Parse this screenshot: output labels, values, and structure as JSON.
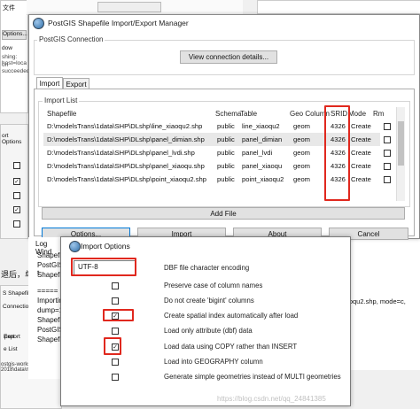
{
  "bg_fragments": {
    "top_left_menu": "文件",
    "options_btn": "Options...",
    "log_lines": [
      "dow",
      "shing: host=loca",
      "on succeeded"
    ],
    "port_options": "ort Options",
    "chinese_snippet": "退后，单",
    "shapefile_se": "S Shapefile Se",
    "connection": "Connection",
    "port_label": "port",
    "export_label": "Export",
    "file_list": "e List",
    "path_snippet": "ostgis-workshop-2018\\data\\nyc",
    "right_snippet": "iaoqu2.shp, mode=c,"
  },
  "main_window": {
    "title": "PostGIS Shapefile Import/Export Manager",
    "connection_group": "PostGIS Connection",
    "view_connection_btn": "View connection details...",
    "tabs": [
      "Import",
      "Export"
    ],
    "import_list_label": "Import List",
    "columns": [
      "Shapefile",
      "Schema",
      "Table",
      "Geo Column",
      "SRID",
      "Mode",
      "Rm"
    ],
    "rows": [
      {
        "shapefile": "D:\\modelsTrans\\1data\\SHP\\DLshp\\line_xiaoqu2.shp",
        "schema": "public",
        "table": "line_xiaoqu2",
        "geo": "geom",
        "srid": "4326",
        "mode": "Create",
        "rm": false
      },
      {
        "shapefile": "D:\\modelsTrans\\1data\\SHP\\DLshp\\panel_dimian.shp",
        "schema": "public",
        "table": "panel_dimian",
        "geo": "geom",
        "srid": "4326",
        "mode": "Create",
        "rm": false
      },
      {
        "shapefile": "D:\\modelsTrans\\1data\\SHP\\DLshp\\panel_lvdi.shp",
        "schema": "public",
        "table": "panel_lvdi",
        "geo": "geom",
        "srid": "4326",
        "mode": "Create",
        "rm": false
      },
      {
        "shapefile": "D:\\modelsTrans\\1data\\SHP\\DLshp\\panel_xiaoqu.shp",
        "schema": "public",
        "table": "panel_xiaoqu",
        "geo": "geom",
        "srid": "4326",
        "mode": "Create",
        "rm": false
      },
      {
        "shapefile": "D:\\modelsTrans\\1data\\SHP\\DLshp\\point_xiaoqu2.shp",
        "schema": "public",
        "table": "point_xiaoqu2",
        "geo": "geom",
        "srid": "4326",
        "mode": "Create",
        "rm": false
      }
    ],
    "add_file_btn": "Add File",
    "buttons": [
      "Options...",
      "Import",
      "About",
      "Cancel"
    ],
    "log_window_label": "Log Wind",
    "log_lines": [
      "Shapefil",
      "PostGIS t",
      "Shapefil",
      "=====",
      "Importin",
      "dump=1,",
      "Shapefile",
      "PostGIS",
      "Shapefile"
    ]
  },
  "import_options": {
    "title": "Import Options",
    "encoding_value": "UTF-8",
    "encoding_label": "DBF file character encoding",
    "options": [
      {
        "label": "Preserve case of column names",
        "checked": false
      },
      {
        "label": "Do not create 'bigint' columns",
        "checked": false
      },
      {
        "label": "Create spatial index automatically after load",
        "checked": true
      },
      {
        "label": "Load only attribute (dbf) data",
        "checked": false
      },
      {
        "label": "Load data using COPY rather than INSERT",
        "checked": true
      },
      {
        "label": "Load into GEOGRAPHY column",
        "checked": false
      },
      {
        "label": "Generate simple geometries instead of MULTI geometries",
        "checked": false
      }
    ],
    "watermark": "https://blog.csdn.net/qq_24841385"
  },
  "colors": {
    "highlight": "#e0281e",
    "checkbox_border": "#333333"
  }
}
